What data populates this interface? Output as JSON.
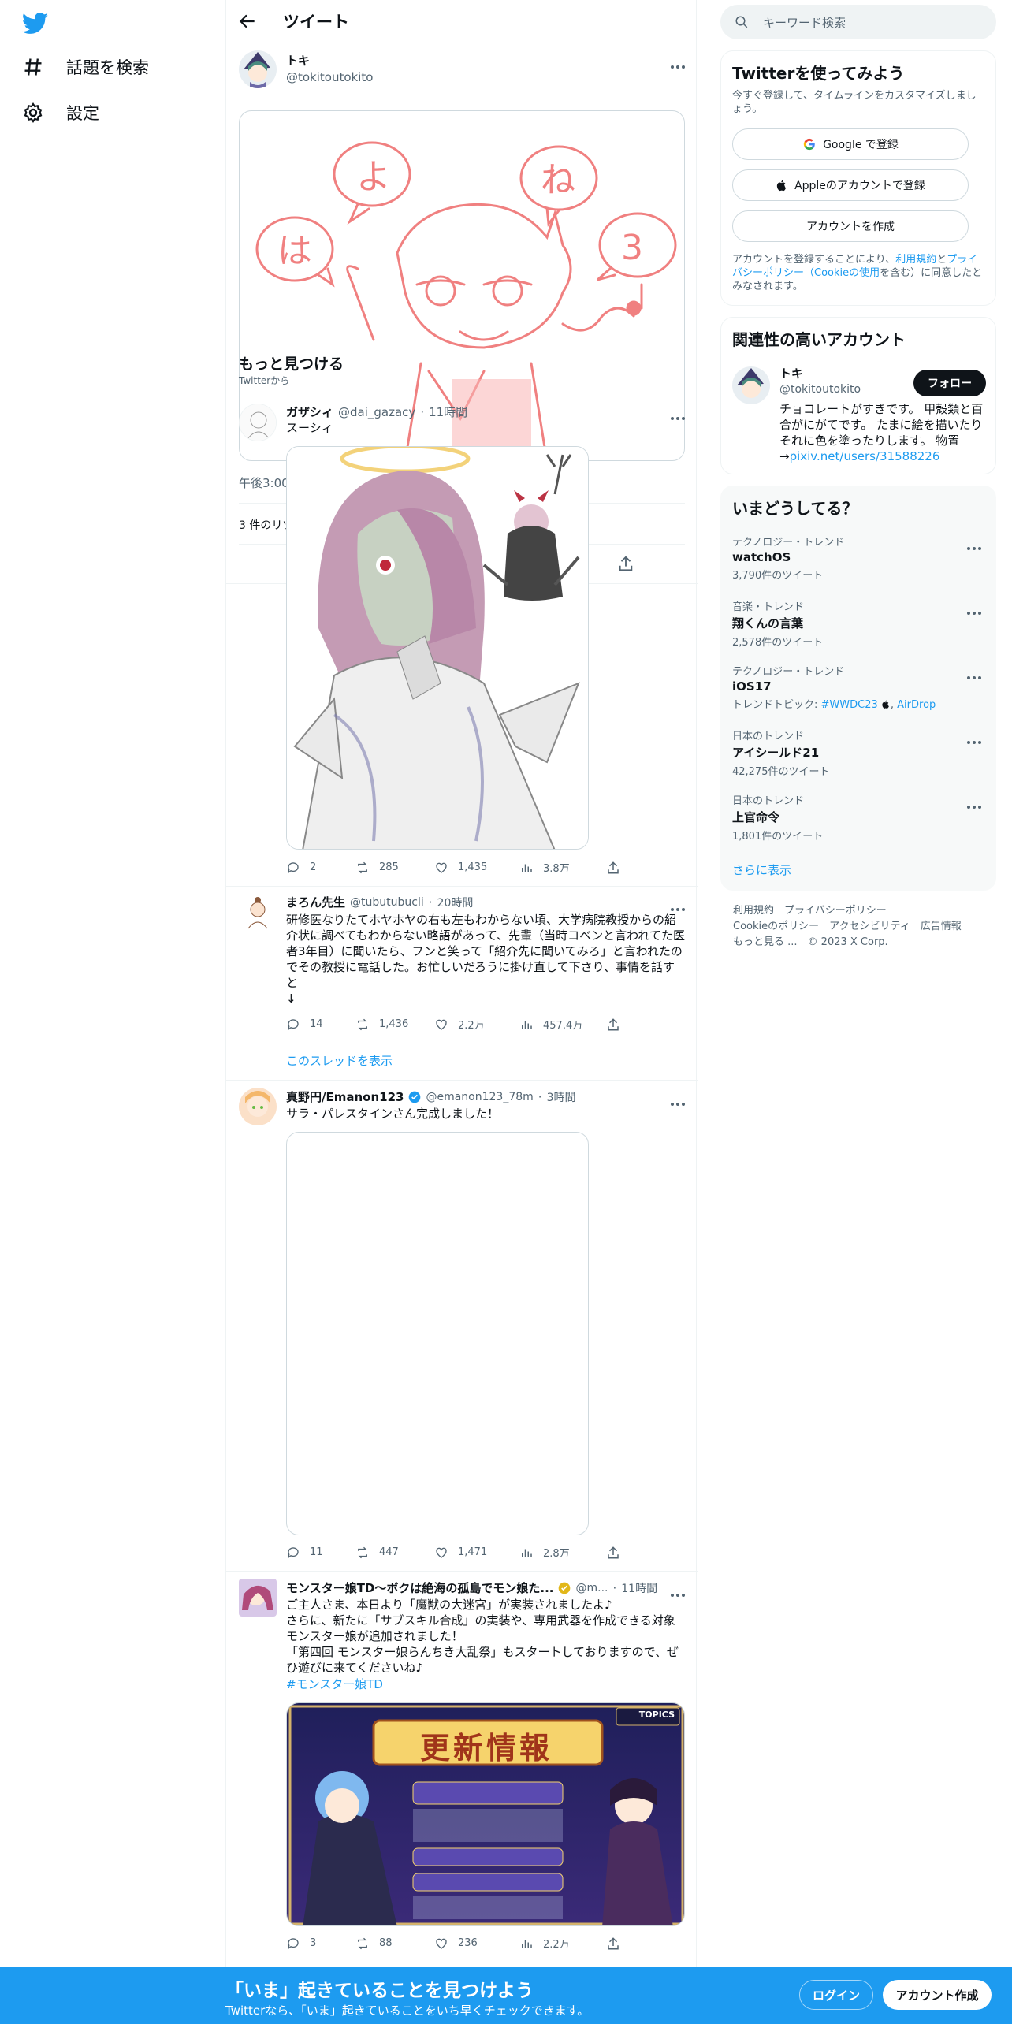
{
  "nav": {
    "items": [
      {
        "label": "話題を検索",
        "icon": "hashtag-icon"
      },
      {
        "label": "設定",
        "icon": "gear-icon"
      }
    ]
  },
  "header": {
    "title": "ツイート"
  },
  "main_tweet": {
    "name": "トキ",
    "handle": "@tokitoutokito",
    "time": "午後3:00",
    "retweets": "3 件のリツイート"
  },
  "discover": {
    "title": "もっと見つける",
    "subtitle": "Twitterから"
  },
  "tweets": [
    {
      "name": "ガザシィ",
      "handle": "@dai_gazacy",
      "time": "11時間",
      "text": "スーシィ",
      "replies": "2",
      "retweets": "285",
      "likes": "1,435",
      "views": "3.8万"
    },
    {
      "name": "まろん先生",
      "handle": "@tubutubucli",
      "time": "20時間",
      "text": "研修医なりたてホヤホヤの右も左もわからない頃、大学病院教授からの紹介状に調べてもわからない略語があって、先輩（当時コベンと言われてた医者3年目）に聞いたら、フンと笑って「紹介先に聞いてみろ」と言われたのでその教授に電話した。お忙しいだろうに掛け直して下さり、事情を話すと\n↓",
      "replies": "14",
      "retweets": "1,436",
      "likes": "2.2万",
      "views": "457.4万",
      "thread_link": "このスレッドを表示"
    },
    {
      "name": "真野円/Emanon123",
      "handle": "@emanon123_78m",
      "time": "3時間",
      "text": "サラ・パレスタインさん完成しました！",
      "replies": "11",
      "retweets": "447",
      "likes": "1,471",
      "views": "2.8万"
    },
    {
      "name": "モンスター娘TD～ボクは絶海の孤島でモン娘た...",
      "handle": "@m...",
      "time": "11時間",
      "text": "ご主人さま、本日より「魔獣の大迷宮」が実装されましたよ♪\nさらに、新たに「サブスキル合成」の実装や、専用武器を作成できる対象モンスター娘が追加されました！\n「第四回 モンスター娘らんちき大乱祭」もスタートしておりますので、ぜひ遊びに来てくださいね♪",
      "hashtag": "#モンスター娘TD",
      "replies": "3",
      "retweets": "88",
      "likes": "236",
      "views": "2.2万",
      "banner": {
        "title": "更新情報",
        "badge": "TOPICS"
      }
    }
  ],
  "right": {
    "search_placeholder": "キーワード検索",
    "signup": {
      "title": "Twitterを使ってみよう",
      "desc": "今すぐ登録して、タイムラインをカスタマイズしましょう。",
      "google": "Google で登録",
      "apple": "Appleのアカウントで登録",
      "create": "アカウントを作成",
      "terms_pre": "アカウントを登録することにより、",
      "terms_link1": "利用規約",
      "terms_mid": "と",
      "terms_link2": "プライバシーポリシー（Cookieの使用",
      "terms_post": "を含む）に同意したとみなされます。"
    },
    "related": {
      "title": "関連性の高いアカウント",
      "name": "トキ",
      "handle": "@tokitoutokito",
      "follow": "フォロー",
      "bio": "チョコレートがすきです。 甲殻類と百合がにがてです。 たまに絵を描いたりそれに色を塗ったりします。 物置→",
      "bio_link": "pixiv.net/users/31588226"
    },
    "trends": {
      "title": "いまどうしてる？",
      "items": [
        {
          "cat": "テクノロジー・トレンド",
          "title": "watchOS",
          "count": "3,790件のツイート"
        },
        {
          "cat": "音楽・トレンド",
          "title": "翔くんの言葉",
          "count": "2,578件のツイート"
        },
        {
          "cat": "テクノロジー・トレンド",
          "title": "iOS17",
          "count": "トレンドトピック: ",
          "topic1": "#WWDC23",
          "topic2": "AirDrop"
        },
        {
          "cat": "日本のトレンド",
          "title": "アイシールド21",
          "count": "42,275件のツイート"
        },
        {
          "cat": "日本のトレンド",
          "title": "上官命令",
          "count": "1,801件のツイート"
        }
      ],
      "show_more": "さらに表示"
    },
    "footer": {
      "line1": [
        "利用規約",
        "プライバシーポリシー"
      ],
      "line2": [
        "Cookieのポリシー",
        "アクセシビリティ",
        "広告情報"
      ],
      "line3": [
        "もっと見る ...",
        "© 2023 X Corp."
      ]
    }
  },
  "bottom": {
    "headline": "「いま」起きていることを見つけよう",
    "sub": "Twitterなら、「いま」起きていることをいち早くチェックできます。",
    "login": "ログイン",
    "signup": "アカウント作成"
  },
  "colors": {
    "accent": "#1d9bf0",
    "text": "#0f1419",
    "muted": "#536471",
    "sketch": "#f08080"
  }
}
